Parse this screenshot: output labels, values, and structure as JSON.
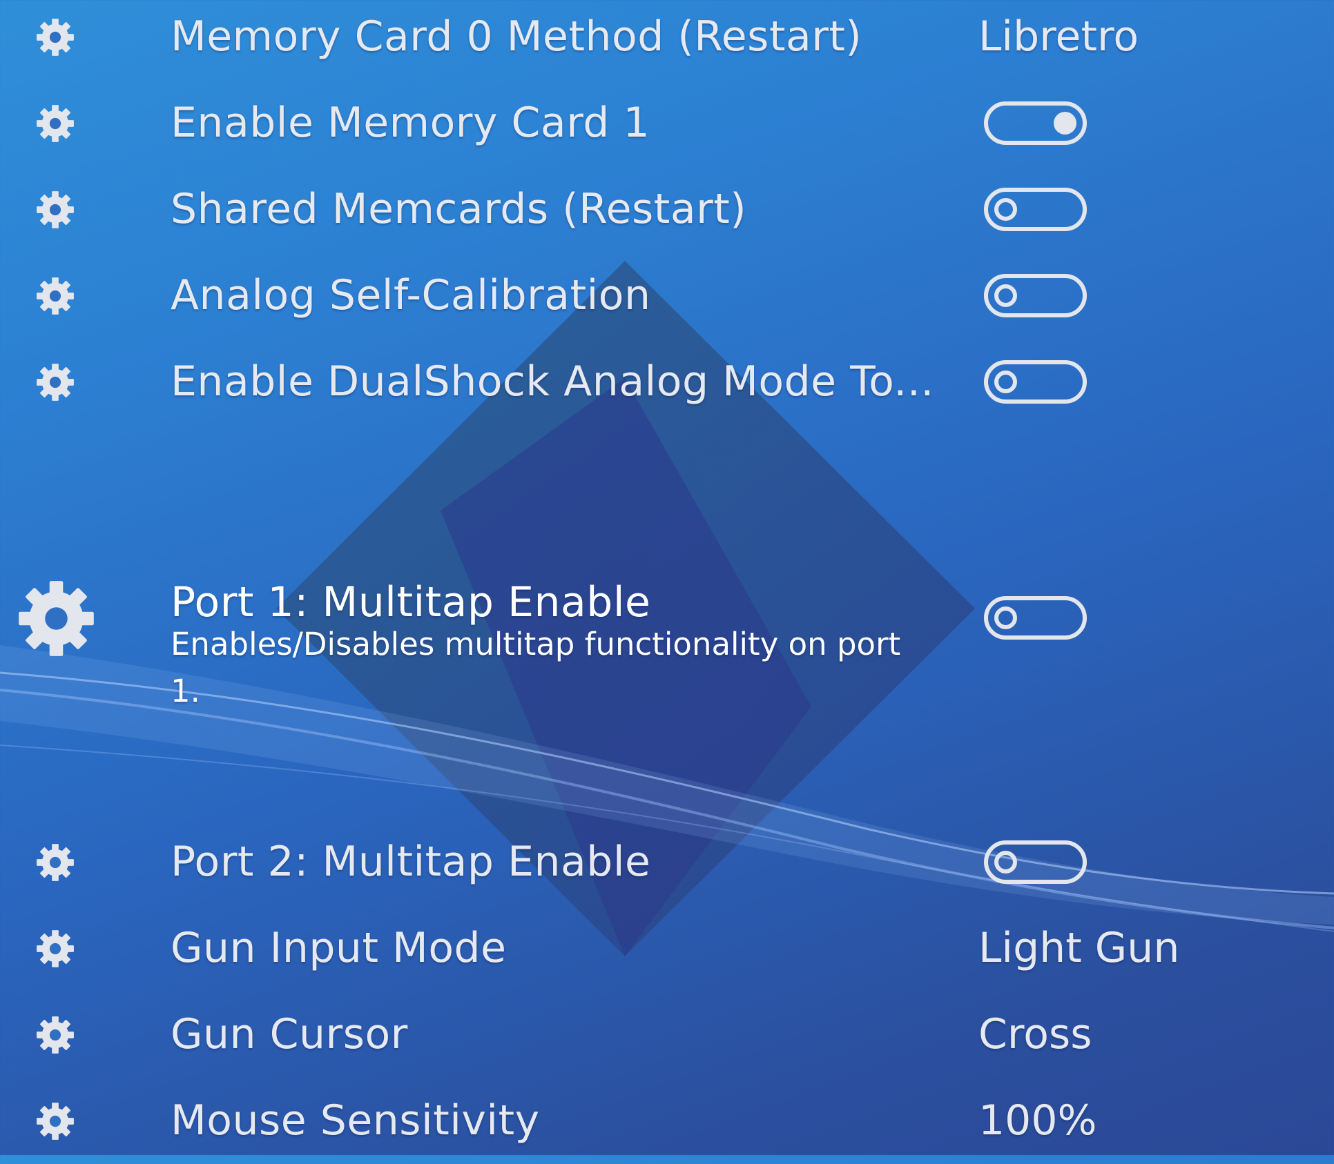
{
  "colors": {
    "background_top": "#2f8fd9",
    "background_bottom": "#2b4896",
    "text": "#e6e9ef",
    "selected_text": "#ffffff",
    "toggle": "#e3e6ec"
  },
  "settings": [
    {
      "label": "Memory Card 0 Method (Restart)",
      "value": "Libretro",
      "icon": "gear-icon"
    },
    {
      "label": "Enable Memory Card 1",
      "toggle": "on",
      "icon": "gear-icon"
    },
    {
      "label": "Shared Memcards (Restart)",
      "toggle": "off",
      "icon": "gear-icon"
    },
    {
      "label": "Analog Self-Calibration",
      "toggle": "off",
      "icon": "gear-icon"
    },
    {
      "label": "Enable DualShock Analog Mode To...",
      "toggle": "off",
      "icon": "gear-icon"
    },
    {
      "label": "Port 1: Multitap Enable",
      "toggle": "off",
      "icon": "gear-icon",
      "selected": true,
      "description": "Enables/Disables multitap functionality on port 1."
    },
    {
      "label": "Port 2: Multitap Enable",
      "toggle": "off",
      "icon": "gear-icon"
    },
    {
      "label": "Gun Input Mode",
      "value": "Light Gun",
      "icon": "gear-icon"
    },
    {
      "label": "Gun Cursor",
      "value": "Cross",
      "icon": "gear-icon"
    },
    {
      "label": "Mouse Sensitivity",
      "value": "100%",
      "icon": "gear-icon"
    }
  ]
}
